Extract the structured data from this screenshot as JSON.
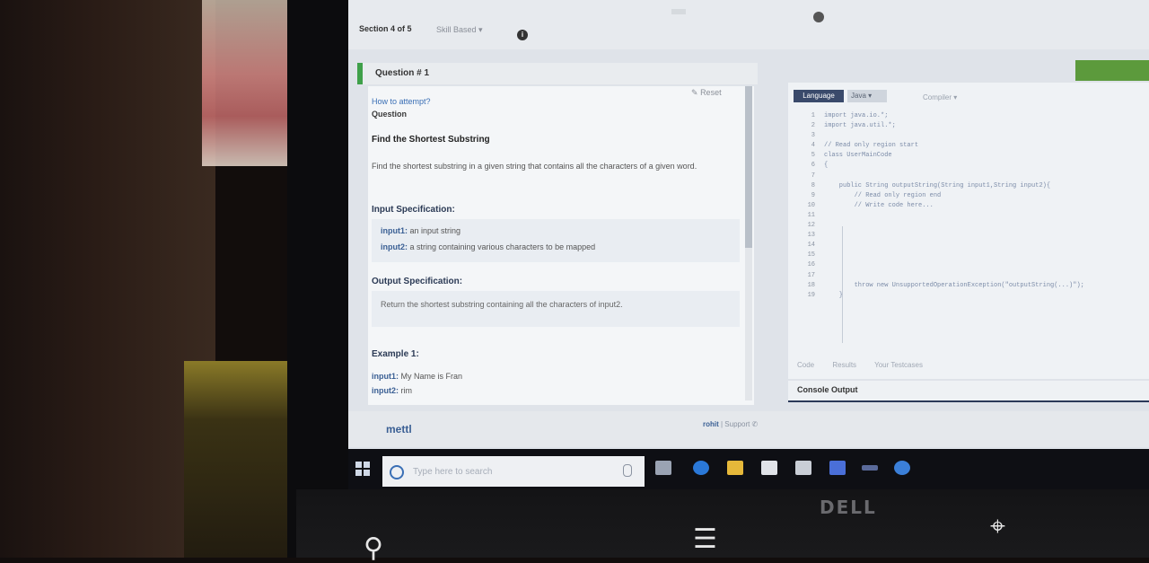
{
  "header": {
    "logo": "",
    "tagline": "",
    "section_label": "Section 4 of 5",
    "section_select": "Skill Based",
    "timer": "",
    "reset": "Reset"
  },
  "question": {
    "number": "Question # 1",
    "how_to_attempt": "How to attempt?",
    "label": "Question",
    "title": "Find the Shortest Substring",
    "text": "Find the shortest substring in a given string that contains all the characters of a given word.",
    "input_spec_heading": "Input Specification:",
    "input1_key": "input1:",
    "input1_desc": " an input string",
    "input2_key": "input2:",
    "input2_desc": " a string containing various characters to be mapped",
    "output_spec_heading": "Output  Specification:",
    "output_desc": "Return the shortest substring containing all the characters of input2.",
    "example_heading": "Example 1:",
    "ex_input1_key": "input1:",
    "ex_input1_val": " My Name is Fran",
    "ex_input2_key": "input2:",
    "ex_input2_val": " rim"
  },
  "editor": {
    "language_button": "Language",
    "language_value": "Java",
    "compiler_label": "Compiler",
    "line_numbers": "1\n2\n3\n4\n5\n6\n7\n8\n9\n10\n11\n12\n13\n14\n15\n16\n17\n18\n19",
    "code": "import java.io.*;\nimport java.util.*;\n\n// Read only region start\nclass UserMainCode\n{\n\n    public String outputString(String input1,String input2){\n        // Read only region end\n        // Write code here...\n\n\n\n\n\n\n\n        throw new UnsupportedOperationException(\"outputString(...)\");\n    }",
    "tab_code": "Code",
    "tab_results": "Results",
    "tab_testcases": "Your Testcases",
    "console_label": "Console Output"
  },
  "footer": {
    "logo": "mettl",
    "user": "rohit",
    "support": " | Support ",
    "phone1": "",
    "phone2": ""
  },
  "taskbar": {
    "search_placeholder": "Type here to search"
  },
  "device": {
    "brand": "DELL"
  }
}
